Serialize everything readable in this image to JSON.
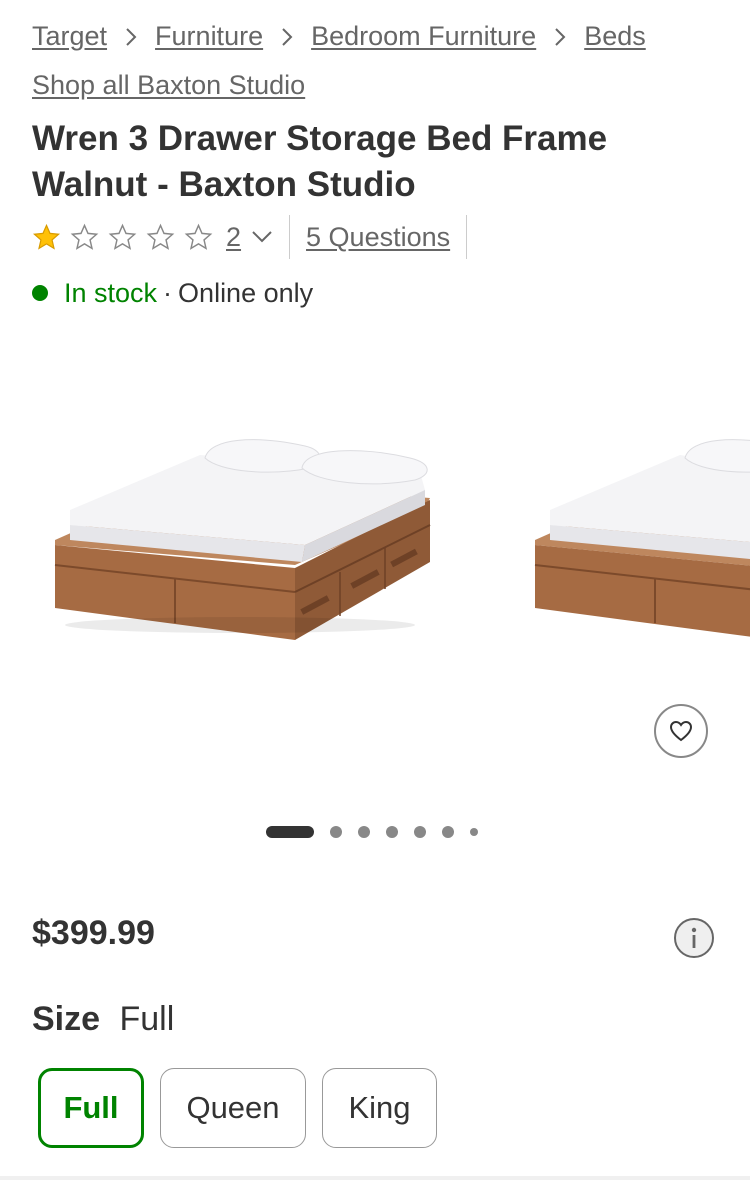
{
  "breadcrumb": {
    "items": [
      {
        "label": "Target"
      },
      {
        "label": "Furniture"
      },
      {
        "label": "Bedroom Furniture"
      },
      {
        "label": "Beds"
      }
    ]
  },
  "brand_link": "Shop all Baxton Studio",
  "product": {
    "title_line1": "Wren 3 Drawer Storage Bed Frame",
    "title_line2": "Walnut - Baxton Studio",
    "rating": {
      "filled_stars": 1,
      "total_stars": 5,
      "review_count": "2"
    },
    "questions_link": "5 Questions",
    "stock": {
      "status": "In stock",
      "separator": "·",
      "availability": "Online only"
    },
    "price": "$399.99"
  },
  "gallery": {
    "image_count": 7,
    "active_index": 0
  },
  "size_selector": {
    "label": "Size",
    "selected_value": "Full",
    "options": [
      {
        "label": "Full",
        "selected": true
      },
      {
        "label": "Queen",
        "selected": false
      },
      {
        "label": "King",
        "selected": false
      }
    ]
  },
  "colors": {
    "text_primary": "#333333",
    "text_secondary": "#666666",
    "in_stock_green": "#008300",
    "star_gold": "#FFC107",
    "wood_walnut": "#A66B43"
  }
}
